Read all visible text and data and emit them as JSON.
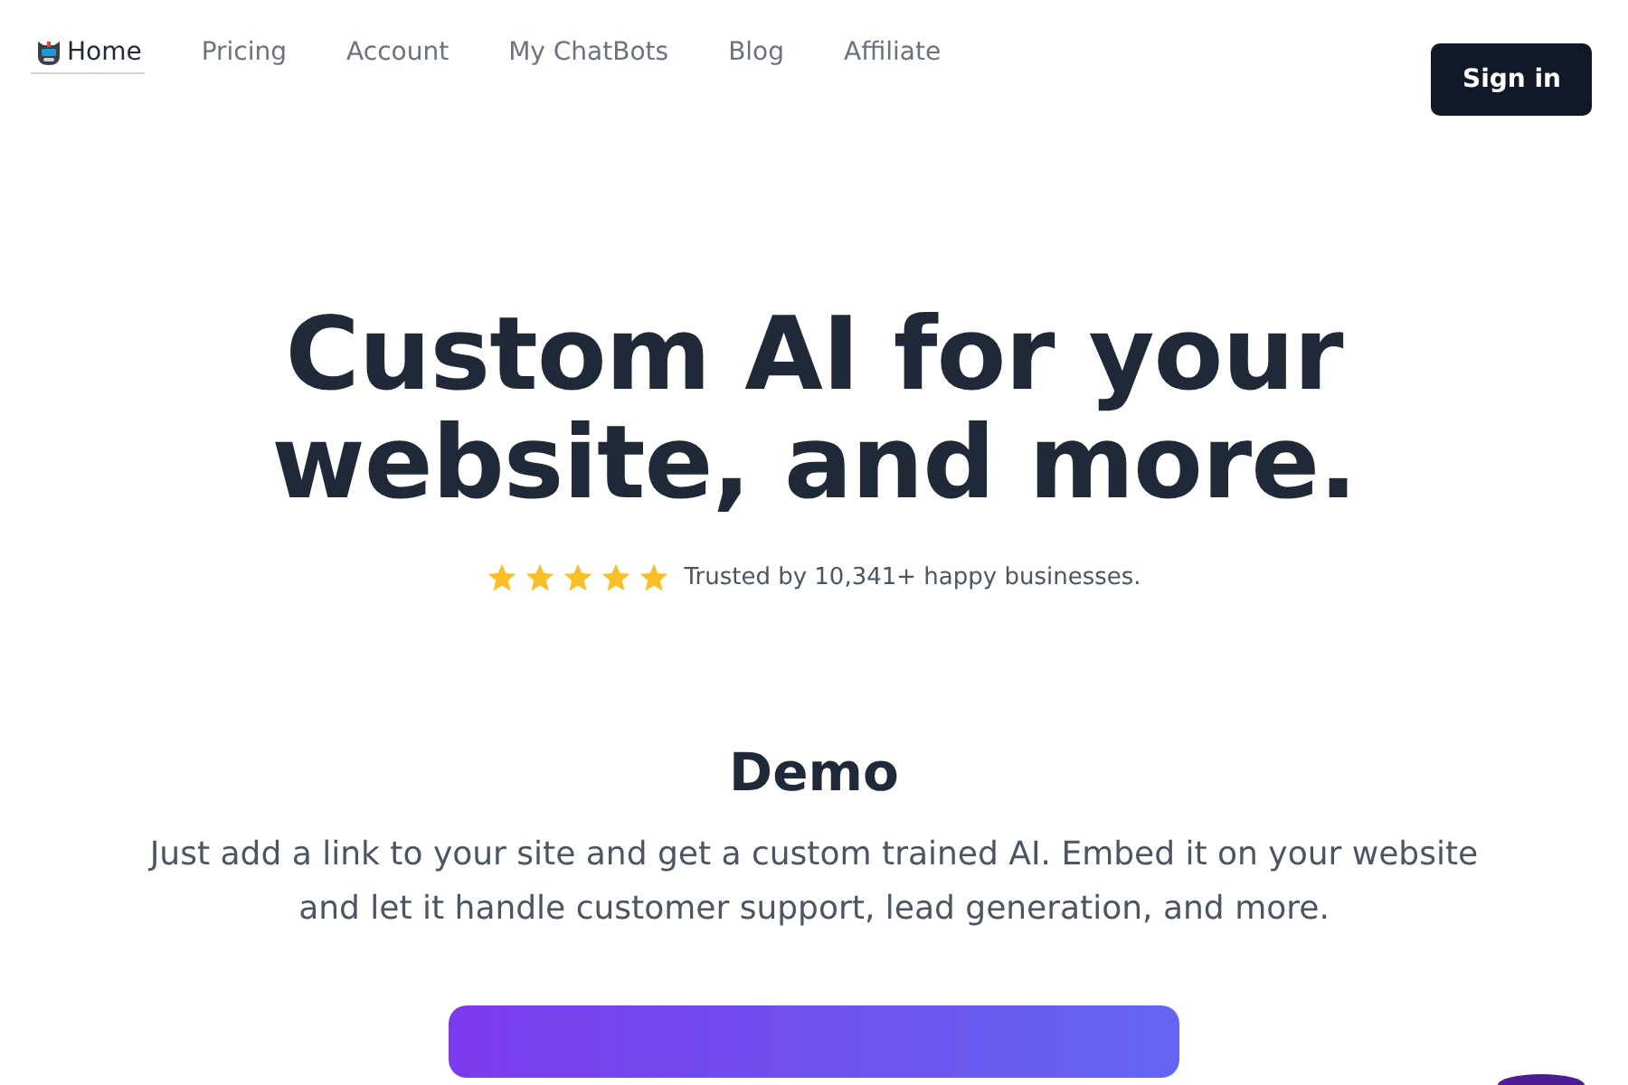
{
  "nav": {
    "items": [
      {
        "label": "Home",
        "selected": true
      },
      {
        "label": "Pricing",
        "selected": false
      },
      {
        "label": "Account",
        "selected": false
      },
      {
        "label": "My ChatBots",
        "selected": false
      },
      {
        "label": "Blog",
        "selected": false
      },
      {
        "label": "Affiliate",
        "selected": false
      }
    ],
    "sign_in": "Sign in"
  },
  "hero": {
    "title_lines": [
      "Custom AI for your",
      "website, and more."
    ],
    "rating": {
      "stars": 5,
      "text": "Trusted by 10,341+ happy businesses."
    }
  },
  "demo": {
    "heading": "Demo",
    "description_lines": [
      "Just add a link to your site and get a custom trained AI. Embed it on your website",
      "and let it handle customer support, lead generation, and more."
    ]
  }
}
